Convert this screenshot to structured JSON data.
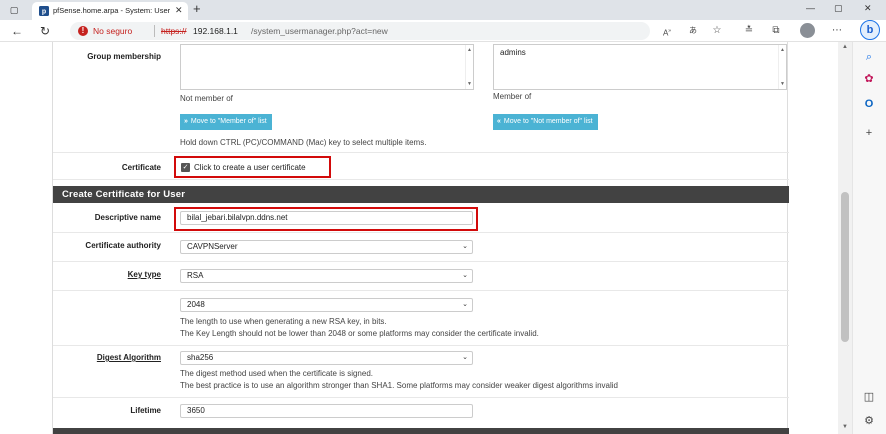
{
  "browser": {
    "tab_title": "pfSense.home.arpa - System: User",
    "url_insecure_label": "No seguro",
    "url_scheme": "https://",
    "url_host": "192.168.1.1",
    "url_path": "/system_usermanager.php?act=new"
  },
  "form": {
    "group_membership": {
      "label": "Group membership",
      "not_member_caption": "Not member of",
      "member_caption": "Member of",
      "member_items": [
        "admins"
      ],
      "move_to_member_button": "Move to \"Member of\" list",
      "move_to_not_member_button": "Move to \"Not member of\" list",
      "hint": "Hold down CTRL (PC)/COMMAND (Mac) key to select multiple items."
    },
    "certificate": {
      "label": "Certificate",
      "checkbox_label": "Click to create a user certificate",
      "checked": true
    }
  },
  "cert_section": {
    "title": "Create Certificate for User",
    "descriptive_name": {
      "label": "Descriptive name",
      "value": "bilal_jebari.bilalvpn.ddns.net"
    },
    "certificate_authority": {
      "label": "Certificate authority",
      "value": "CAVPNServer"
    },
    "key_type": {
      "label": "Key type",
      "value": "RSA",
      "length_value": "2048",
      "help1": "The length to use when generating a new RSA key, in bits.",
      "help2": "The Key Length should not be lower than 2048 or some platforms may consider the certificate invalid."
    },
    "digest_algorithm": {
      "label": "Digest Algorithm",
      "value": "sha256",
      "help1": "The digest method used when the certificate is signed.",
      "help2": "The best practice is to use an algorithm stronger than SHA1. Some platforms may consider weaker digest algorithms invalid"
    },
    "lifetime": {
      "label": "Lifetime",
      "value": "3650"
    }
  },
  "colors": {
    "section_header": "#424242",
    "info_button": "#4bb3d4",
    "highlight": "#d20a0a",
    "insecure": "#c5221f"
  }
}
